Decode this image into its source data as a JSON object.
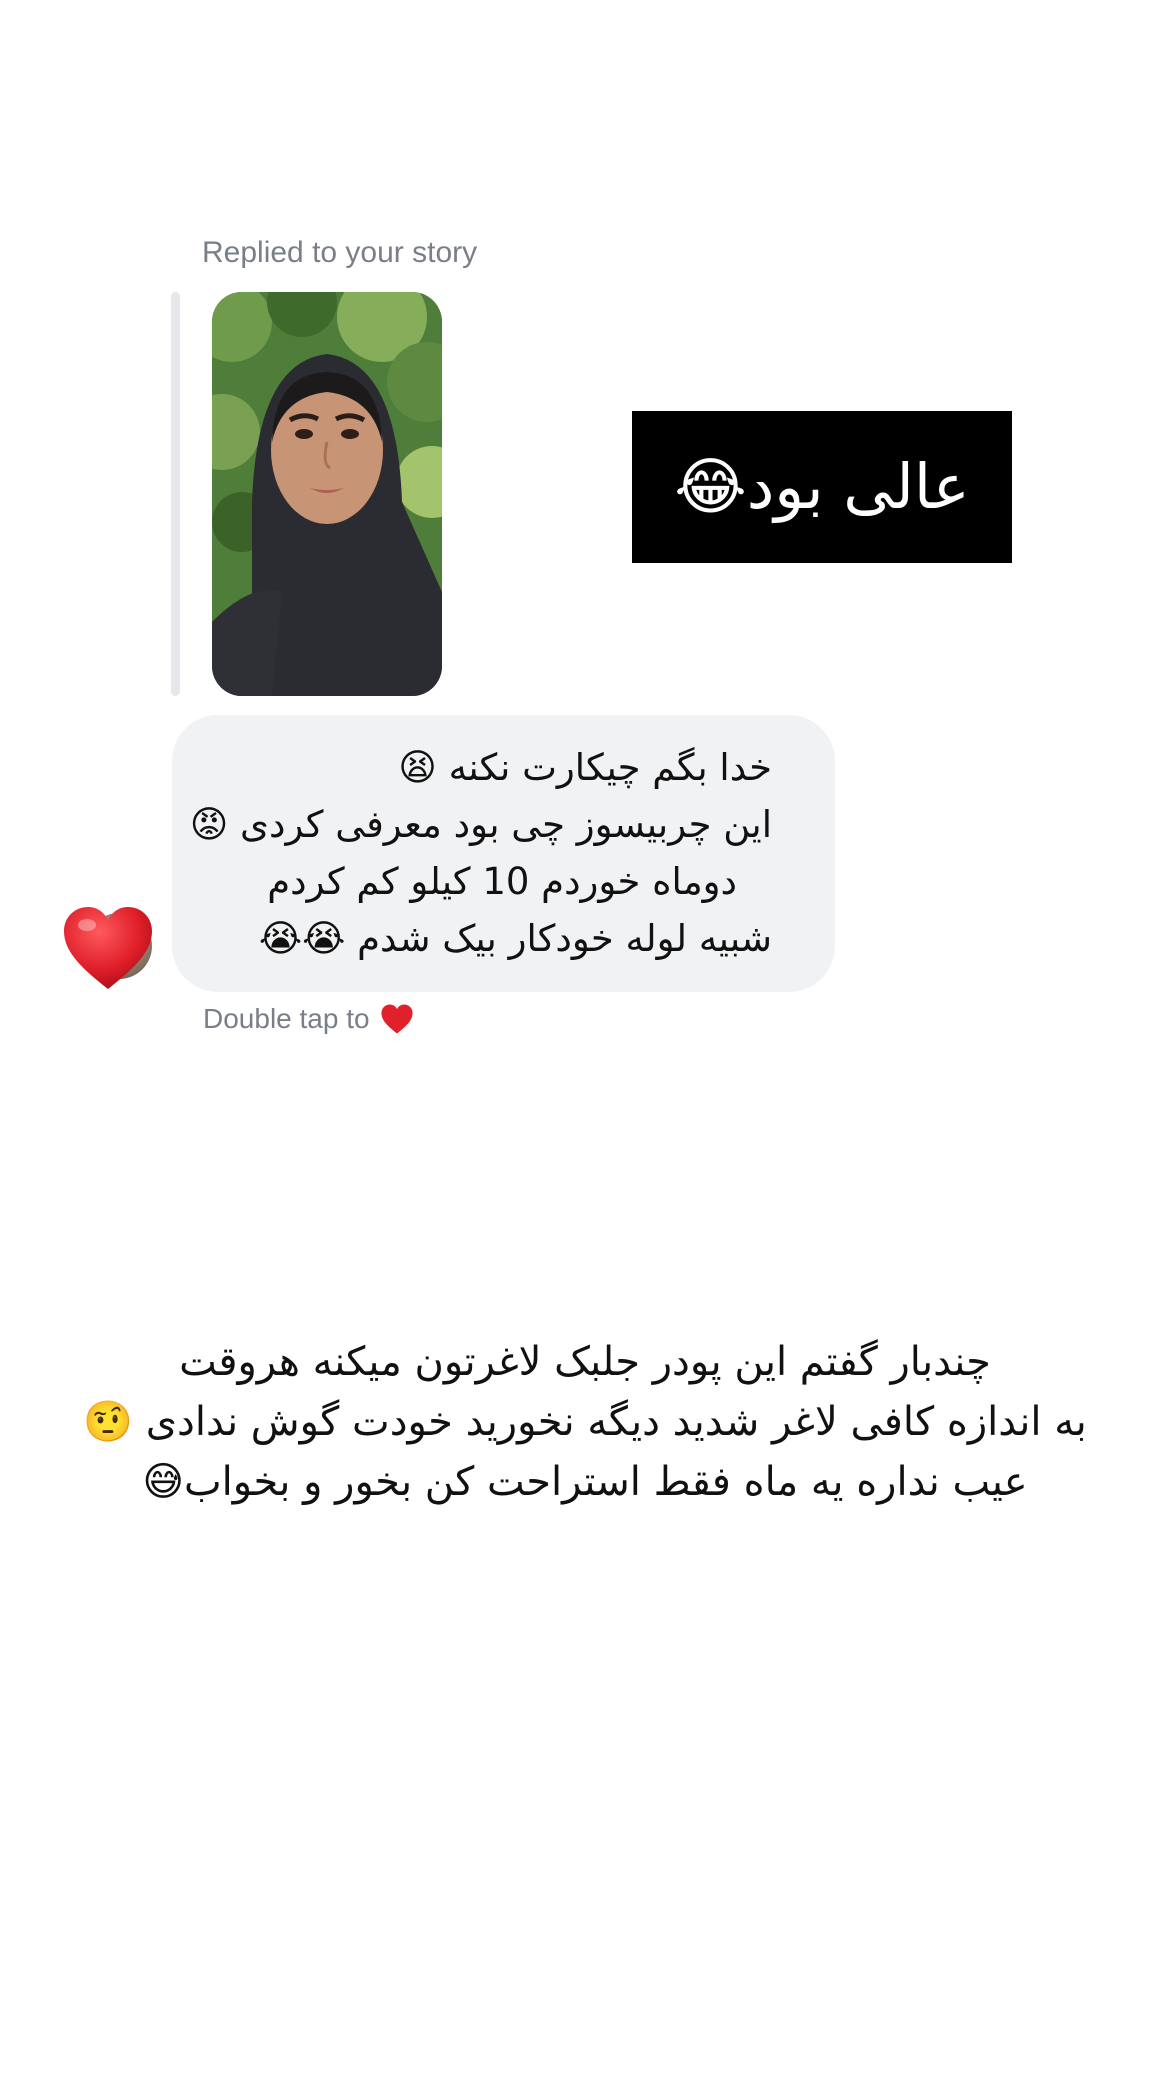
{
  "story_reply": {
    "label": "Replied to your story",
    "caption": "عالی بود😂"
  },
  "message": {
    "lines": [
      "خدا بگم چیکارت نکنه 😫",
      "این چربیسوز چی بود معرفی کردی 😡",
      "دوماه خوردم 10 کیلو کم کردم",
      "شبیه لوله خودکار بیک شدم 😭😭"
    ],
    "reaction_icon": "red-heart",
    "double_tap_label": "Double tap to"
  },
  "overlay": {
    "lines": [
      "چندبار گفتم این پودر جلبک لاغرتون میکنه هروقت",
      "به اندازه کافی لاغر شدید دیگه نخورید خودت گوش ندادی 🤨",
      "عیب نداره یه ماه فقط استراحت کن بخور و بخواب😅"
    ]
  },
  "colors": {
    "background": "#ffffff",
    "bubble": "#f1f2f4",
    "meta_text": "#7a7f87",
    "heart": "#e0202a"
  }
}
